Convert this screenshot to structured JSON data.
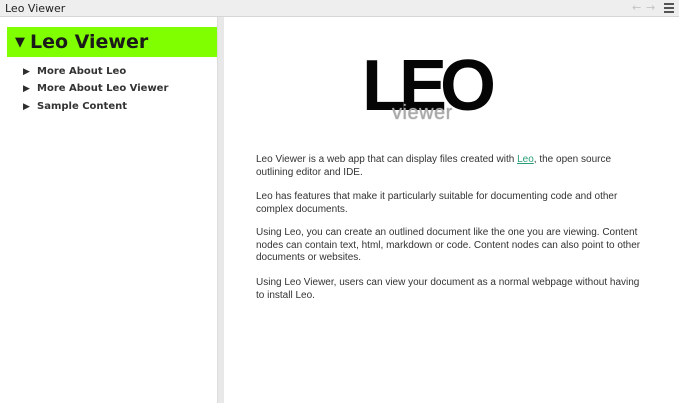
{
  "window": {
    "title": "Leo Viewer",
    "back_icon": "arrow-left-icon",
    "forward_icon": "arrow-right-icon",
    "menu_icon": "hamburger-menu-icon"
  },
  "outline": {
    "root": {
      "label": "Leo Viewer",
      "expanded": true,
      "highlight": "#80ff00"
    },
    "children": [
      {
        "label": "More About Leo"
      },
      {
        "label": "More About Leo Viewer"
      },
      {
        "label": "Sample Content"
      }
    ]
  },
  "content": {
    "logo": {
      "main": "LEO",
      "sub": "viewer"
    },
    "paragraphs": {
      "p1_before": "Leo Viewer is a web app that can display files created with ",
      "p1_link": "Leo",
      "p1_after": ", the open source outlining editor and IDE.",
      "p2": "Leo has features that make it particularly suitable for documenting code and other complex documents.",
      "p3": "Using Leo, you can create an outlined document like the one you are viewing. Content nodes can contain text, html, markdown or code. Content nodes can also point to other documents or websites.",
      "p4": "Using Leo Viewer, users can view your document as a normal webpage without having to install Leo."
    },
    "link_color": "#2a9d75"
  }
}
